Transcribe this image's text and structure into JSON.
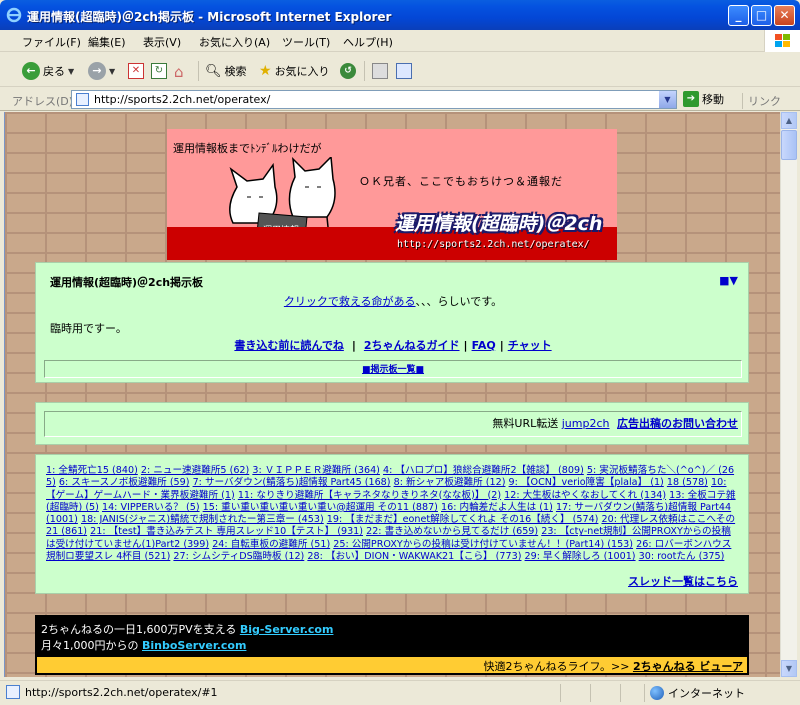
{
  "window": {
    "title": "運用情報(超臨時)＠2ch掲示板 - Microsoft Internet Explorer"
  },
  "menu": [
    "ファイル(F)",
    "編集(E)",
    "表示(V)",
    "お気に入り(A)",
    "ツール(T)",
    "ヘルプ(H)"
  ],
  "toolbar": {
    "back": "戻る",
    "search": "検索",
    "favorites": "お気に入り"
  },
  "address": {
    "label": "アドレス(D)",
    "url": "http://sports2.2ch.net/operatex/",
    "go": "移動",
    "links": "リンク"
  },
  "banner": {
    "text1": "運用情報板までﾄﾝﾃﾞﾙわけだが",
    "text2": "ＯＫ兄者、ここでもおちけつ＆通報だ",
    "logo": "運用情報(超臨時)＠2ch",
    "url": "http://sports2.2ch.net/operatex/"
  },
  "board": {
    "title": "運用情報(超臨時)＠2ch掲示板",
    "nav": "■▼",
    "click_link": "クリックで救える命がある",
    "click_rest": "、、、らしいです。",
    "notice": "臨時用ですー。",
    "guide": [
      "書き込む前に読んでね",
      "2ちゃんねるガイド",
      "FAQ",
      "チャット"
    ],
    "board_list": "■掲示板一覧■"
  },
  "ad": {
    "text": "無料URL転送 ",
    "link1": "jump2ch",
    "link2": "広告出稿のお問い合わせ"
  },
  "threads": [
    "1: 全鯖死亡15 (840)",
    "2: ニュー速避難所5 (62)",
    "3: ＶＩＰＰＥＲ避難所 (364)",
    "4: 【ハロプロ】狼総合避難所2【雑談】 (809)",
    "5: 実況板鯖落ちた＼(^o^)／ (265)",
    "6: スキースノボ板避難所 (59)",
    "7: サーバダウン(鯖落ち)超情報 Part45 (168)",
    "8: 新シャア板避難所 (12)",
    "9: 【OCN】verio障害【plala】 (1)",
    "18 (578)",
    "10: 【ゲーム】ゲームハード・業界板避難所 (1)",
    "11: なりきり避難所【キャラネタなりきりネタ(なな板)】 (2)",
    "12: 大生板はやくなおしてくれ (134)",
    "13: 全板コテ雑(超臨時) (5)",
    "14: VIPPERいる？ (5)",
    "15: 重い重い重い重い重い重い@超運用 その11 (887)",
    "16: 内輪差だよ人生は (1)",
    "17: サーバダウン(鯖落ち)超情報 Part44 (1001)",
    "18: JANIS(ジャニス)鯖統で規制されたー第三章ー (453)",
    "19: 【まだまだ】eonet解除してくれよ その16【続く】 (574)",
    "20: 代理レス依頼はここへその21 (861)",
    "21: 【test】書き込みテスト 専用スレッド10【テスト】 (931)",
    "22: 書き込めないから見てるだけ (659)",
    "23: 【cty-net規制】公開PROXYからの投稿は受け付けていません(1)Part2 (399)",
    "24: 自転車板の避難所 (51)",
    "25: 公開PROXYからの投稿は受け付けていません！！(Part14) (153)",
    "26: ロバーボンハウス規制ロ要望スレ 4杯目 (521)",
    "27: シムシティDS臨時板 (12)",
    "28: 【おい】DION・WAKWAK21【こら】 (773)",
    "29: 早く解除しろ (1001)",
    "30: rootたん (375)"
  ],
  "thread_more": "スレッド一覧はこちら",
  "bottom": {
    "line1": "2ちゃんねるの一日1,600万PVを支える ",
    "line1_link": "Big-Server.com",
    "line2": "月々1,000円からの ",
    "line2_link": "BinboServer.com",
    "yellow_text": "快適2ちゃんねるライフ。>> ",
    "yellow_link": "2ちゃんねる ビューア"
  },
  "status": {
    "text": "http://sports2.2ch.net/operatex/#1",
    "zone": "インターネット"
  }
}
